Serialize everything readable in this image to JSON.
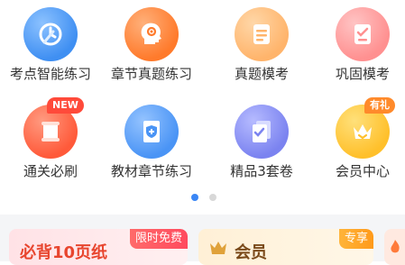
{
  "grid": {
    "items": [
      {
        "label": "考点智能练习",
        "icon": "clock-icon",
        "color": "#3f8ff2"
      },
      {
        "label": "章节真题练习",
        "icon": "head-gear-icon",
        "color": "#ff7a2b"
      },
      {
        "label": "真题模考",
        "icon": "document-icon",
        "color": "#ffb46b"
      },
      {
        "label": "巩固模考",
        "icon": "checklist-icon",
        "color": "#ff9090"
      },
      {
        "label": "通关必刷",
        "icon": "scroll-icon",
        "color": "#ff5a3a",
        "badge": "NEW"
      },
      {
        "label": "教材章节练习",
        "icon": "book-shield-icon",
        "color": "#4a94f5"
      },
      {
        "label": "精品3套卷",
        "icon": "papers-check-icon",
        "color": "#7b83f0"
      },
      {
        "label": "会员中心",
        "icon": "crown-icon",
        "color": "#ffc02b",
        "badge": "有礼"
      }
    ]
  },
  "pager": {
    "pages": 2,
    "active": 0
  },
  "cards": {
    "card1": {
      "title": "必背10页纸",
      "tag": "限时免费"
    },
    "card2": {
      "title": "会员",
      "tag": "专享"
    }
  },
  "colors": {
    "accent_blue": "#3a86f5",
    "badge_red": "#ff4a3a",
    "badge_orange": "#ff8a2b",
    "title_red": "#e8452e",
    "card1_bg": "#ffe6e8",
    "card2_bg": "#fff3dc"
  }
}
